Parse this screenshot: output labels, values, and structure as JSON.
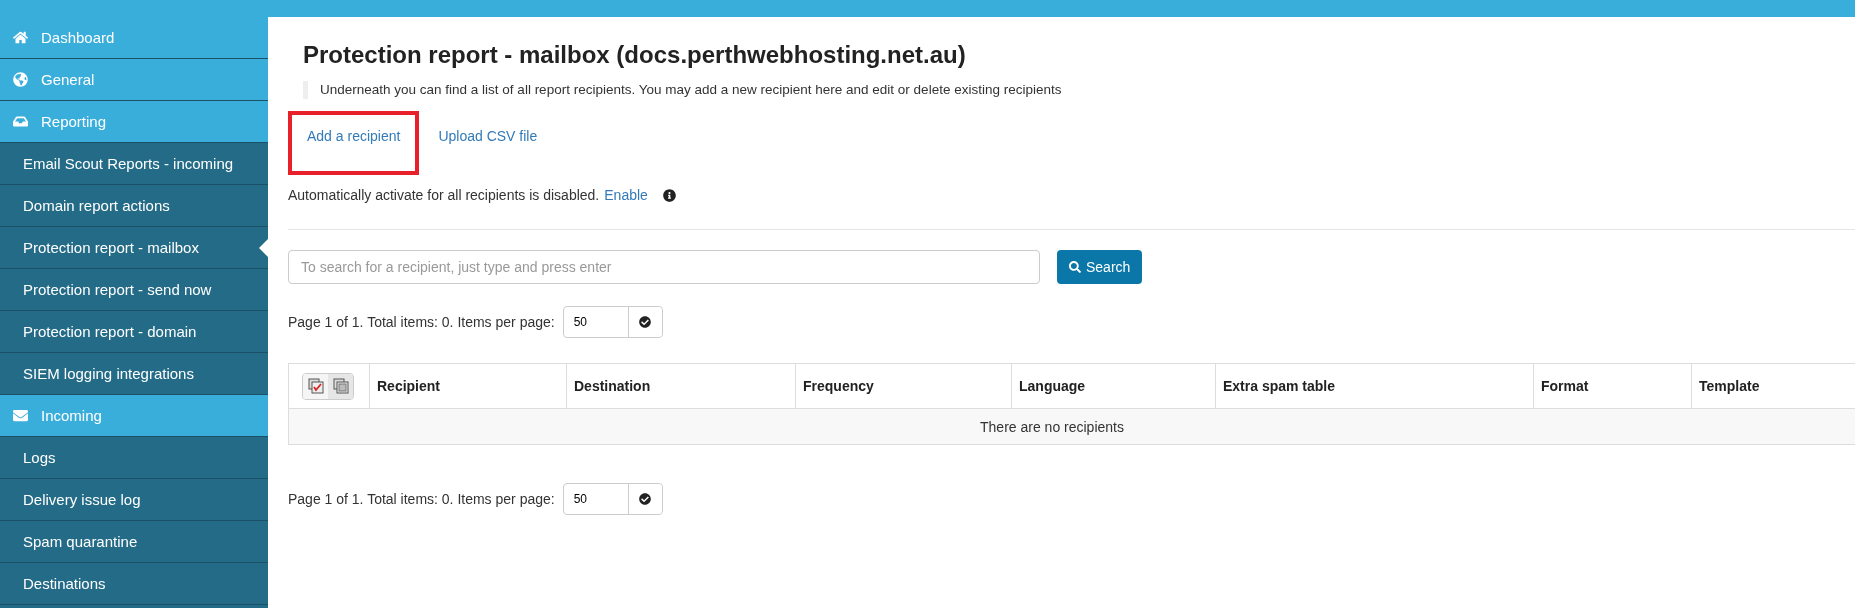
{
  "sidebar": {
    "items": [
      {
        "kind": "section",
        "label": "Dashboard",
        "selected": false
      },
      {
        "kind": "section",
        "label": "General",
        "selected": false
      },
      {
        "kind": "section",
        "label": "Reporting",
        "selected": false
      },
      {
        "kind": "item",
        "label": "Email Scout Reports - incoming",
        "selected": false
      },
      {
        "kind": "item",
        "label": "Domain report actions",
        "selected": false
      },
      {
        "kind": "item",
        "label": "Protection report - mailbox",
        "selected": true
      },
      {
        "kind": "item",
        "label": "Protection report - send now",
        "selected": false
      },
      {
        "kind": "item",
        "label": "Protection report - domain",
        "selected": false
      },
      {
        "kind": "item",
        "label": "SIEM logging integrations",
        "selected": false
      },
      {
        "kind": "section",
        "label": "Incoming",
        "selected": false
      },
      {
        "kind": "item",
        "label": "Logs",
        "selected": false
      },
      {
        "kind": "item",
        "label": "Delivery issue log",
        "selected": false
      },
      {
        "kind": "item",
        "label": "Spam quarantine",
        "selected": false
      },
      {
        "kind": "item",
        "label": "Destinations",
        "selected": false
      }
    ]
  },
  "page": {
    "title": "Protection report - mailbox (docs.perthwebhosting.net.au)",
    "description": "Underneath you can find a list of all report recipients. You may add a new recipient here and edit or delete existing recipients",
    "actions": [
      {
        "label": "Add a recipient",
        "highlighted": true
      },
      {
        "label": "Upload CSV file",
        "highlighted": false
      }
    ],
    "auto_activate": {
      "text": "Automatically activate for all recipients is disabled.",
      "link": "Enable"
    },
    "search": {
      "placeholder": "To search for a recipient, just type and press enter",
      "button": "Search"
    },
    "pager_top": {
      "text": "Page 1 of 1. Total items: 0. Items per page:",
      "per_page": "50"
    },
    "table": {
      "columns": [
        "Recipient",
        "Destination",
        "Frequency",
        "Language",
        "Extra spam table",
        "Format",
        "Template"
      ],
      "empty_message": "There are no recipients"
    },
    "pager_bottom": {
      "text": "Page 1 of 1. Total items: 0. Items per page:",
      "per_page": "50"
    }
  }
}
